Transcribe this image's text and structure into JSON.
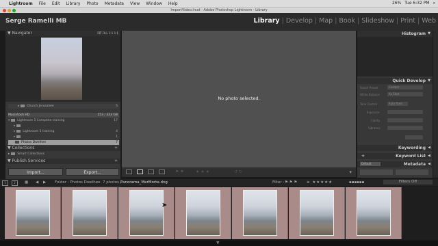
{
  "menubar": {
    "apple": "",
    "items": [
      "Lightroom",
      "File",
      "Edit",
      "Library",
      "Photo",
      "Metadata",
      "View",
      "Window",
      "Help"
    ],
    "status": [
      "26%",
      "Tue 6:32 PM",
      "Q"
    ]
  },
  "window": {
    "title": "ImportVideo.lrcat - Adobe Photoshop Lightroom - Library"
  },
  "identity_plate": "Serge Ramelli MB",
  "modules": [
    "Library",
    "Develop",
    "Map",
    "Book",
    "Slideshow",
    "Print",
    "Web"
  ],
  "active_module": "Library",
  "left_panel": {
    "navigator": {
      "title": "Navigator",
      "zoom_options": [
        "FIT",
        "FILL",
        "1:1",
        "1:1"
      ]
    },
    "folders": [
      {
        "name": "Church Jerusalem",
        "count": "5"
      },
      {
        "name": "Macintosh HD",
        "count": "153 / 333 GB"
      },
      {
        "name": "Lightroom 5 Complete training",
        "count": "17"
      },
      {
        "name": "",
        "count": ""
      },
      {
        "name": "Lightroom 5 training",
        "count": "4"
      },
      {
        "name": "",
        "count": "1"
      },
      {
        "name": "Photos Dwelhee",
        "count": "7"
      }
    ],
    "collections": {
      "title": "Collections",
      "items": [
        {
          "name": "Smart Collections"
        }
      ]
    },
    "publish": {
      "title": "Publish Services"
    },
    "import_label": "Import...",
    "export_label": "Export..."
  },
  "center": {
    "message": "No photo selected."
  },
  "right_panel": {
    "histogram": "Histogram",
    "quick_develop": "Quick Develop",
    "qd_rows": [
      "Saved Preset",
      "White Balance",
      "Tone Control",
      "Exposure",
      "Clarity",
      "Vibrance"
    ],
    "qd_values": [
      "Custom",
      "As Shot",
      "Auto Tone",
      "",
      "",
      ""
    ],
    "keywording": "Keywording",
    "keyword_list": "Keyword List",
    "metadata": "Metadata",
    "metadata_value": "Default"
  },
  "filmstrip_bar": {
    "page_btns": [
      "1",
      "2"
    ],
    "source": "Folder : Photos Dwelhee",
    "count": "7 photos /",
    "selected": "Panorama_MerMorte.dng",
    "filter_label": "Filter :",
    "filters_off": "Filters Off"
  },
  "filmstrip": {
    "thumbs": 7
  }
}
